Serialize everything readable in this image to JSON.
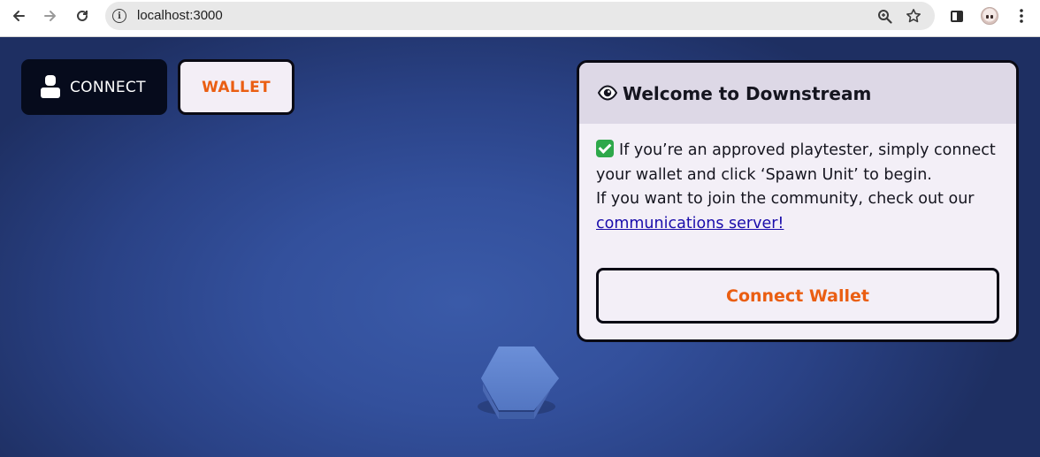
{
  "browser": {
    "url": "localhost:3000",
    "icons": {
      "back": "arrow-left-icon",
      "forward": "arrow-right-icon",
      "reload": "reload-icon",
      "site_info": "info-icon",
      "zoom": "zoom-icon",
      "bookmark": "star-icon",
      "side_panel": "side-panel-icon",
      "profile": "profile-avatar",
      "menu": "more-vertical-icon"
    }
  },
  "game": {
    "toolbar": {
      "connect_label": "CONNECT",
      "wallet_label": "WALLET"
    },
    "welcome": {
      "title": "Welcome to Downstream",
      "line1": "If you’re an approved playtester, simply connect your wallet and click ‘Spawn Unit’ to begin.",
      "line2": "If you want to join the community, check out our",
      "link_text": "communications server!",
      "button_label": "Connect Wallet"
    },
    "colors": {
      "accent": "#ea5e12",
      "dark": "#060b1c",
      "panel_bg": "#f3eff7",
      "panel_header": "#ddd8e6",
      "hex_tile": "#5a7fcb",
      "check": "#2ea84a"
    }
  }
}
